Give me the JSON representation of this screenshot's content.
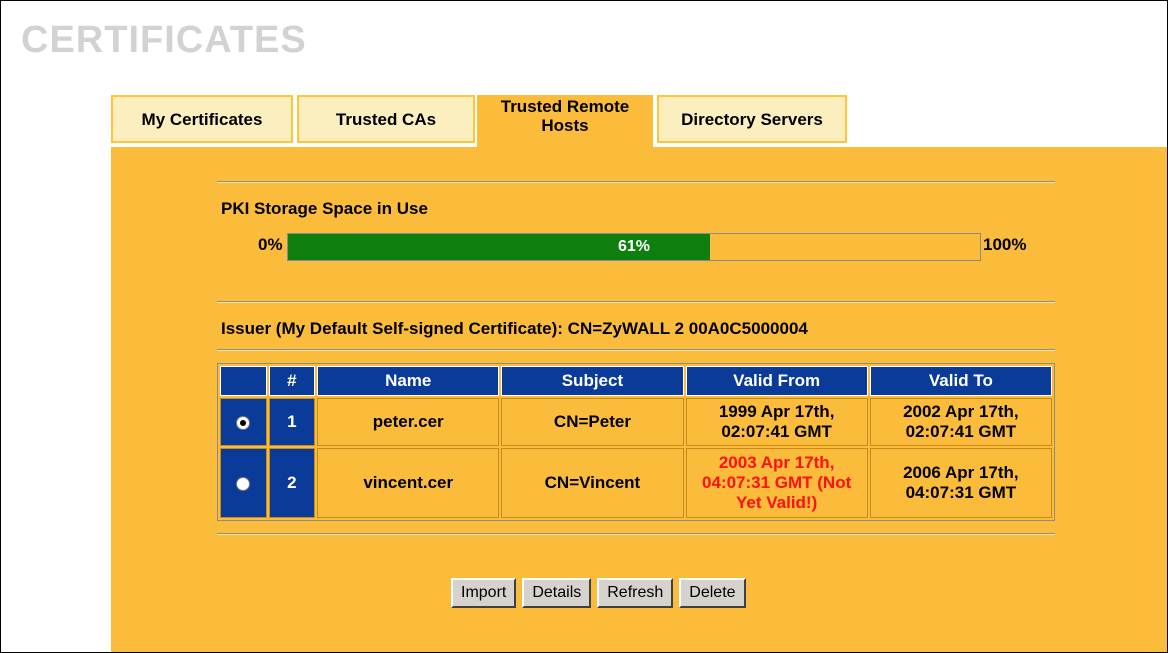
{
  "page": {
    "title": "CERTIFICATES"
  },
  "tabs": [
    {
      "label": "My Certificates",
      "active": false
    },
    {
      "label": "Trusted CAs",
      "active": false
    },
    {
      "label": "Trusted Remote Hosts",
      "label_line1": "Trusted Remote",
      "label_line2": "Hosts",
      "active": true
    },
    {
      "label": "Directory Servers",
      "active": false
    }
  ],
  "storage": {
    "label": "PKI Storage Space in Use",
    "min_label": "0%",
    "max_label": "100%",
    "used_percent": 61,
    "used_label": "61%",
    "fill_color": "#0e7f0e"
  },
  "issuer": {
    "text": "Issuer (My Default Self-signed Certificate): CN=ZyWALL 2 00A0C5000004"
  },
  "table": {
    "headers": {
      "select": "",
      "index": "#",
      "name": "Name",
      "subject": "Subject",
      "valid_from": "Valid From",
      "valid_to": "Valid To"
    },
    "rows": [
      {
        "selected": true,
        "index": "1",
        "name": "peter.cer",
        "subject": "CN=Peter",
        "valid_from_line1": "1999 Apr 17th,",
        "valid_from_line2": "02:07:41 GMT",
        "valid_from_line3": "",
        "valid_to_line1": "2002 Apr 17th,",
        "valid_to_line2": "02:07:41 GMT",
        "not_yet_valid": false
      },
      {
        "selected": false,
        "index": "2",
        "name": "vincent.cer",
        "subject": "CN=Vincent",
        "valid_from_line1": "2003 Apr 17th,",
        "valid_from_line2": "04:07:31 GMT (Not",
        "valid_from_line3": "Yet Valid!)",
        "valid_to_line1": "2006 Apr 17th,",
        "valid_to_line2": "04:07:31 GMT",
        "not_yet_valid": true
      }
    ]
  },
  "buttons": {
    "import": "Import",
    "details": "Details",
    "refresh": "Refresh",
    "delete": "Delete"
  },
  "colors": {
    "panel": "#fbbc3c",
    "tab_inactive": "#fbefc0",
    "header_blue": "#0a3b98",
    "warning_red": "#ff1010"
  }
}
